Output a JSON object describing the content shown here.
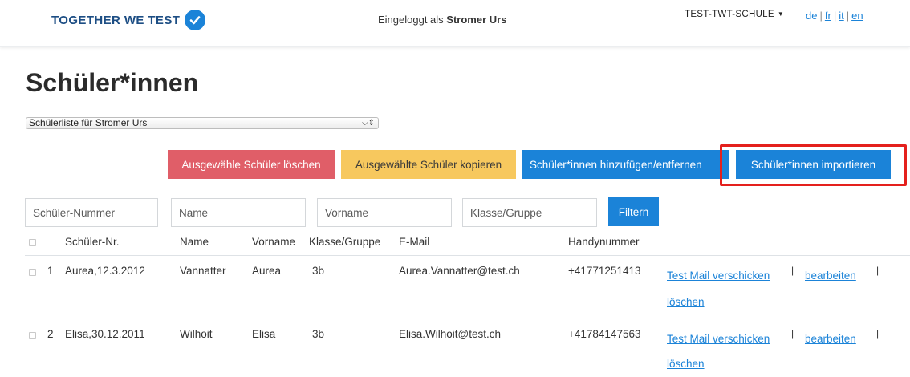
{
  "header": {
    "logo_text": "TOGETHER WE TEST",
    "login_prefix": "Eingeloggt als",
    "login_user": "Stromer Urs",
    "school": "TEST-TWT-SCHULE",
    "languages": [
      "de",
      "fr",
      "it",
      "en"
    ],
    "current_language": "de",
    "language_separator": "|"
  },
  "page": {
    "title": "Schüler*innen",
    "list_select_value": "Schülerliste für Stromer Urs"
  },
  "actions": {
    "delete_label": "Ausgewähle Schüler löschen",
    "copy_label": "Ausgewählte Schüler kopieren",
    "add_remove_label": "Schüler*innen hinzufügen/entfernen",
    "import_label": "Schüler*innen importieren"
  },
  "filters": {
    "number_placeholder": "Schüler-Nummer",
    "name_placeholder": "Name",
    "firstname_placeholder": "Vorname",
    "class_placeholder": "Klasse/Gruppe",
    "filter_button": "Filtern"
  },
  "table": {
    "headers": {
      "number": "Schüler-Nr.",
      "name": "Name",
      "firstname": "Vorname",
      "class": "Klasse/Gruppe",
      "email": "E-Mail",
      "phone": "Handynummer"
    },
    "rows": [
      {
        "index": "1",
        "number": "Aurea,12.3.2012",
        "name": "Vannatter",
        "firstname": "Aurea",
        "class": "3b",
        "email": "Aurea.Vannatter@test.ch",
        "phone": "+41771251413"
      },
      {
        "index": "2",
        "number": "Elisa,30.12.2011",
        "name": "Wilhoit",
        "firstname": "Elisa",
        "class": "3b",
        "email": "Elisa.Wilhoit@test.ch",
        "phone": "+41784147563"
      }
    ],
    "row_actions": {
      "test_mail": "Test Mail verschicken",
      "edit": "bearbeiten",
      "delete": "löschen",
      "separator": "|"
    }
  },
  "colors": {
    "primary": "#1b83d8",
    "danger": "#e05e68",
    "warning": "#f7c85e",
    "logo": "#1d4e84",
    "highlight": "#e4201d"
  },
  "icons": {
    "logo_check": "check-circle-icon",
    "dropdown": "caret-down-icon",
    "select": "select-arrows-icon"
  }
}
